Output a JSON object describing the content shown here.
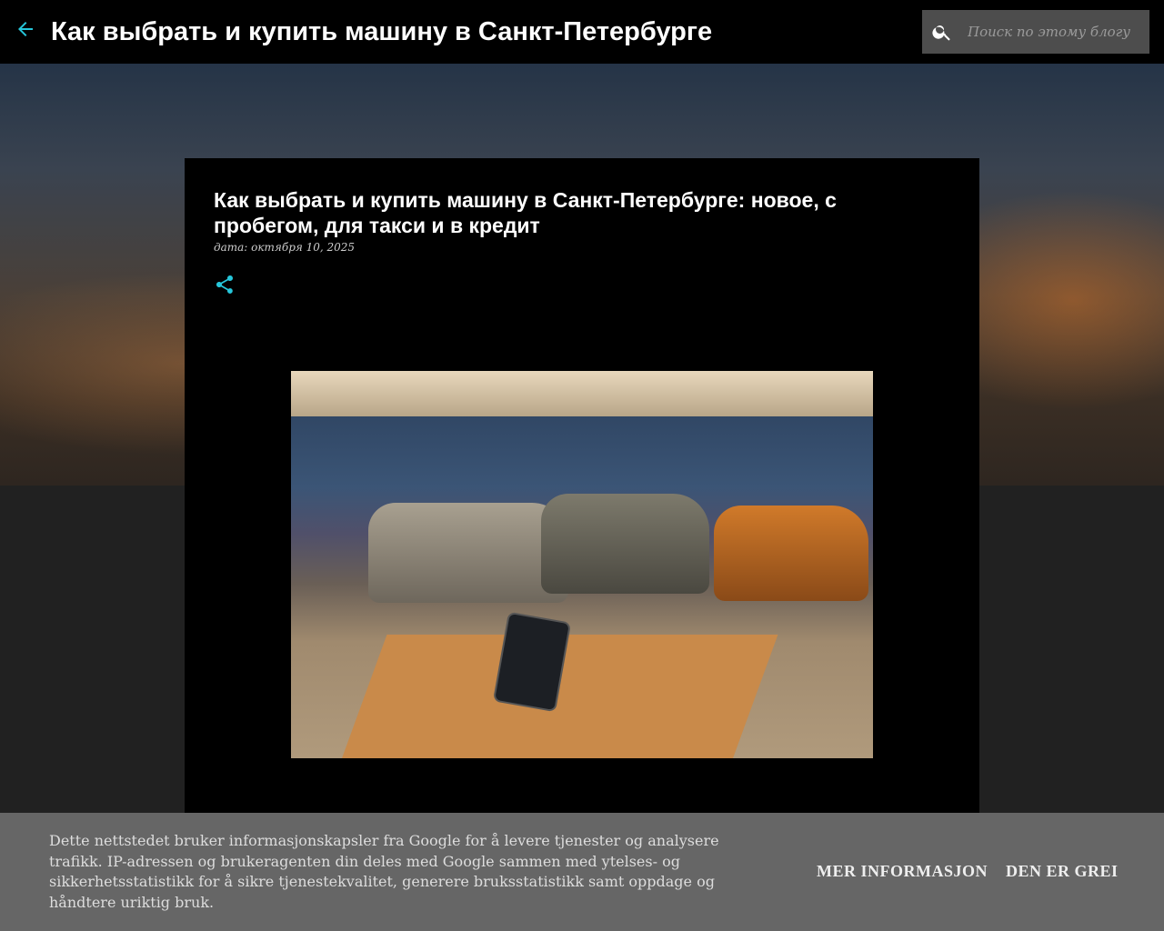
{
  "header": {
    "title": "Как выбрать и купить машину в Санкт-Петербурге",
    "search_placeholder": "Поиск по этому блогу"
  },
  "post": {
    "title": "Как выбрать и купить машину в Санкт-Петербурге: новое, с пробегом, для такси и в кредит",
    "date": "дата: октября 10, 2025"
  },
  "cookie": {
    "text": "Dette nettstedet bruker informasjonskapsler fra Google for å levere tjenester og analysere trafikk. IP-adressen og brukeragenten din deles med Google sammen med ytelses- og sikkerhetsstatistikk for å sikre tjenestekvalitet, generere bruksstatistikk samt oppdage og håndtere uriktig bruk.",
    "more_label": "MER INFORMASJON",
    "ok_label": "DEN ER GREI"
  },
  "colors": {
    "accent": "#26c6da",
    "header_bg": "#000000",
    "cookie_bg": "#666666"
  }
}
